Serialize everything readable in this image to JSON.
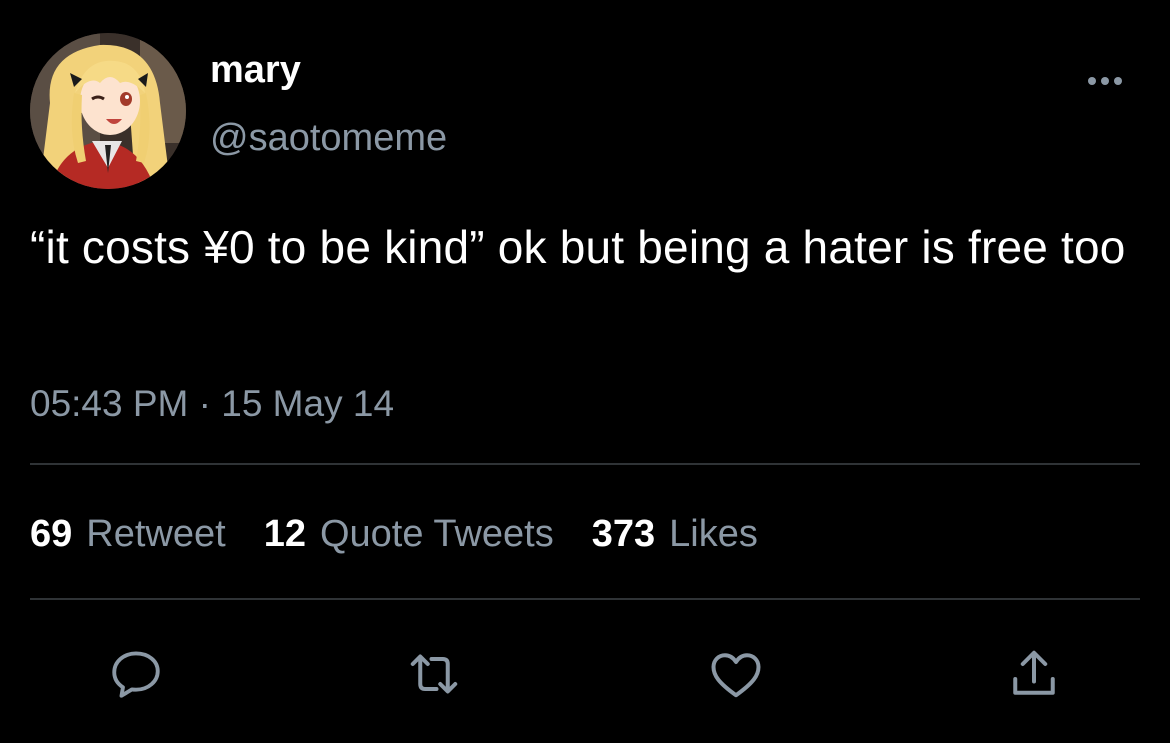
{
  "user": {
    "display_name": "mary",
    "handle": "@saotomeme",
    "avatar_icon": "anime-avatar"
  },
  "tweet": {
    "text": "“it costs ¥0 to be kind” ok but being a hater is free too",
    "timestamp": "05:43 PM · 15 May 14"
  },
  "stats": [
    {
      "count": "69",
      "label": "Retweet"
    },
    {
      "count": "12",
      "label": "Quote Tweets"
    },
    {
      "count": "373",
      "label": "Likes"
    }
  ],
  "actions": [
    "reply-icon",
    "retweet-icon",
    "like-icon",
    "share-icon"
  ],
  "colors": {
    "background": "#000000",
    "primary_text": "#ffffff",
    "secondary_text": "#8b98a5",
    "divider": "#2f3336"
  }
}
